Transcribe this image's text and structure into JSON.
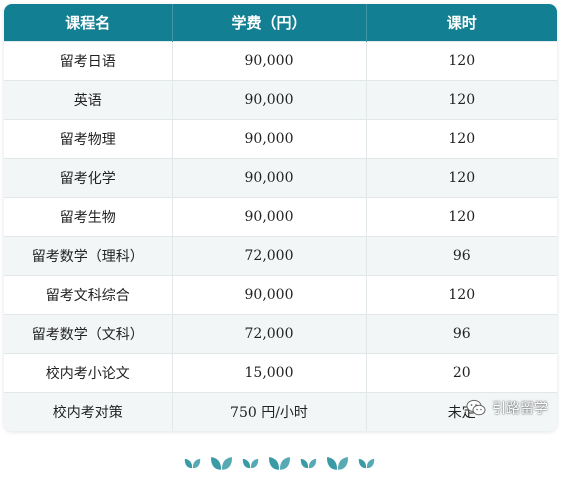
{
  "table": {
    "headers": [
      "课程名",
      "学费（円）",
      "课时"
    ],
    "rows": [
      [
        "留考日语",
        "90,000",
        "120"
      ],
      [
        "英语",
        "90,000",
        "120"
      ],
      [
        "留考物理",
        "90,000",
        "120"
      ],
      [
        "留考化学",
        "90,000",
        "120"
      ],
      [
        "留考生物",
        "90,000",
        "120"
      ],
      [
        "留考数学（理科）",
        "72,000",
        "96"
      ],
      [
        "留考文科综合",
        "90,000",
        "120"
      ],
      [
        "留考数学（文科）",
        "72,000",
        "96"
      ],
      [
        "校内考小论文",
        "15,000",
        "20"
      ],
      [
        "校内考对策",
        "750 円/小时",
        "未定"
      ]
    ]
  },
  "watermark": {
    "icon": "wechat-icon",
    "text": "引路留学"
  },
  "decoration": {
    "icon": "leaf-icon",
    "count": 7
  },
  "colors": {
    "header_bg": "#137f92",
    "header_text": "#ffffff",
    "row_alt_bg": "#f2f6f7",
    "leaf": "#3a9aa6"
  }
}
